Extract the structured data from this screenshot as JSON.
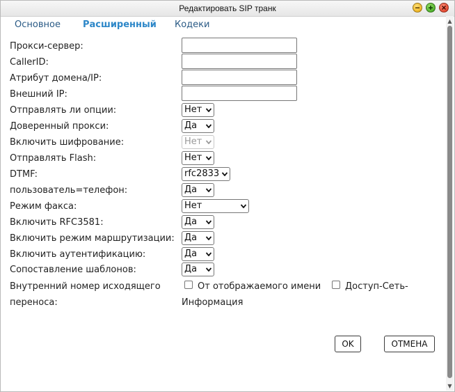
{
  "window": {
    "title": "Редактировать SIP транк"
  },
  "tabs": [
    {
      "label": "Основное"
    },
    {
      "label": "Расширенный"
    },
    {
      "label": "Кодеки"
    }
  ],
  "fields": {
    "proxy_server": {
      "label": "Прокси-сервер:",
      "value": ""
    },
    "caller_id": {
      "label": "CallerID:",
      "value": ""
    },
    "domain_attr": {
      "label": "Атрибут домена/IP:",
      "value": ""
    },
    "external_ip": {
      "label": "Внешний IP:",
      "value": ""
    },
    "send_options": {
      "label": "Отправлять ли опции:",
      "value": "Нет"
    },
    "trusted_proxy": {
      "label": "Доверенный прокси:",
      "value": "Да"
    },
    "encryption": {
      "label": "Включить шифрование:",
      "value": "Нет"
    },
    "send_flash": {
      "label": "Отправлять Flash:",
      "value": "Нет"
    },
    "dtmf": {
      "label": "DTMF:",
      "value": "rfc2833"
    },
    "user_phone": {
      "label": "пользователь=телефон:",
      "value": "Да"
    },
    "fax_mode": {
      "label": "Режим факса:",
      "value": "Нет"
    },
    "rfc3581": {
      "label": "Включить RFC3581:",
      "value": "Да"
    },
    "routing_mode": {
      "label": "Включить режим маршрутизации:",
      "value": "Да"
    },
    "auth": {
      "label": "Включить аутентификацию:",
      "value": "Да"
    },
    "pattern_match": {
      "label": "Сопоставление шаблонов:",
      "value": "Да"
    },
    "outgoing_transfer": {
      "label_line1": "Внутренний номер исходящего",
      "label_line2": "переноса:",
      "option1": "От отображаемого имени",
      "option2_line1": "Доступ-Сеть-",
      "option2_line2": "Информация"
    }
  },
  "buttons": {
    "ok": "OK",
    "cancel": "ОТМЕНА"
  }
}
